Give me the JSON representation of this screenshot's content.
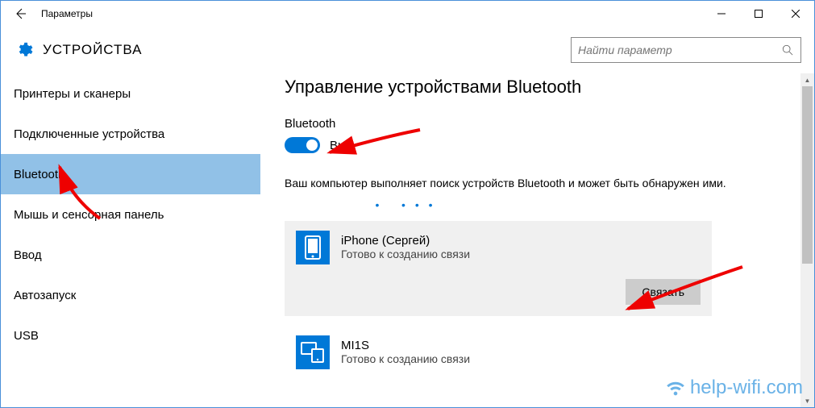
{
  "window": {
    "title": "Параметры"
  },
  "header": {
    "title": "УСТРОЙСТВА",
    "search_placeholder": "Найти параметр"
  },
  "sidebar": {
    "items": [
      {
        "label": "Принтеры и сканеры"
      },
      {
        "label": "Подключенные устройства"
      },
      {
        "label": "Bluetooth"
      },
      {
        "label": "Мышь и сенсорная панель"
      },
      {
        "label": "Ввод"
      },
      {
        "label": "Автозапуск"
      },
      {
        "label": "USB"
      }
    ]
  },
  "content": {
    "page_title": "Управление устройствами Bluetooth",
    "section_label": "Bluetooth",
    "toggle_state": "Вкл.",
    "info_text": "Ваш компьютер выполняет поиск устройств Bluetooth и может быть обнаружен ими.",
    "devices": [
      {
        "name": "iPhone (Сергей)",
        "status": "Готово к созданию связи",
        "selected": true
      },
      {
        "name": "MI1S",
        "status": "Готово к созданию связи",
        "selected": false
      }
    ],
    "pair_btn": "Связать"
  },
  "watermark": "help-wifi.com"
}
